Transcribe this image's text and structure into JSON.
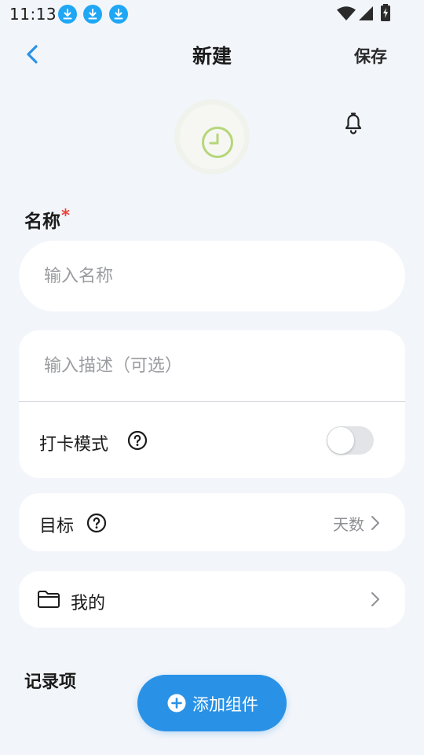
{
  "status_bar": {
    "time": "11:13",
    "notifications": [
      "download-icon",
      "download-icon",
      "download-icon"
    ],
    "system_icons": [
      "wifi-icon",
      "signal-icon",
      "battery-charging-icon"
    ]
  },
  "header": {
    "title": "新建",
    "save_label": "保存",
    "back_icon": "chevron-left-icon"
  },
  "icon_picker": {
    "icon": "clock-icon",
    "icon_color": "#b5d67a",
    "reminder_icon": "bell-icon"
  },
  "form": {
    "name_label": "名称",
    "required_mark": "*",
    "name_placeholder": "输入名称",
    "description_placeholder": "输入描述（可选）",
    "checkin_mode_label": "打卡模式",
    "checkin_mode_enabled": false,
    "goal_label": "目标",
    "goal_value": "天数",
    "folder_label": "我的",
    "records_label": "记录项"
  },
  "actions": {
    "add_component_label": "添加组件"
  },
  "colors": {
    "accent": "#2a92e6",
    "background": "#f2f5fa",
    "card": "#ffffff",
    "required": "#e8453c",
    "notification_blue": "#1fa7f5"
  }
}
